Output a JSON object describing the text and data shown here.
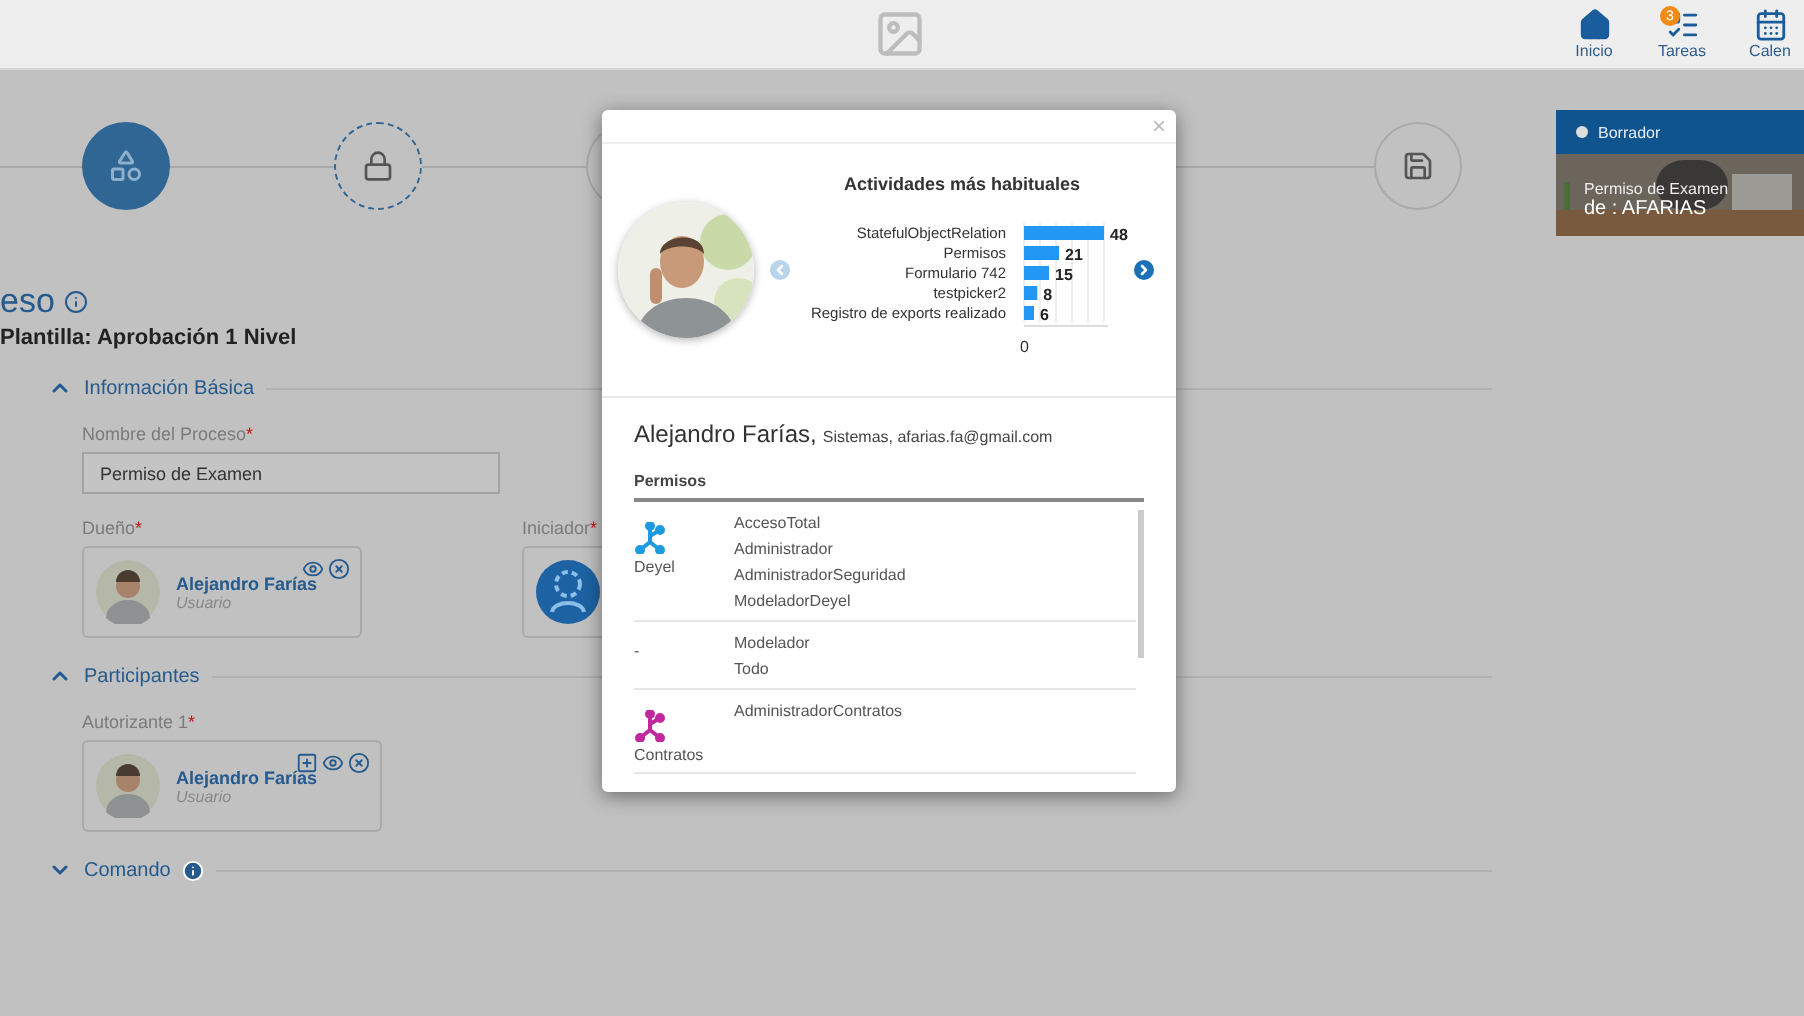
{
  "top_bar": {
    "nav": [
      {
        "kind": "home",
        "label": "Inicio"
      },
      {
        "kind": "tasks",
        "label": "Tareas",
        "badge": "3"
      },
      {
        "kind": "calendar",
        "label": "Calen"
      }
    ]
  },
  "stepper": {
    "steps": [
      {
        "kind": "shapes",
        "selected": true
      },
      {
        "kind": "lock",
        "selected": false
      },
      {
        "kind": "blank",
        "selected": false
      },
      {
        "kind": "save",
        "selected": false
      }
    ]
  },
  "form": {
    "title": "eso",
    "subtitle": "Plantilla: Aprobación 1 Nivel",
    "sections": [
      {
        "title": "Información Básica",
        "expanded": true,
        "info": false,
        "fields": [
          {
            "label": "Nombre del Proceso",
            "mark": "*",
            "value": "Permiso de Examen"
          }
        ],
        "people": [
          {
            "kind": "user",
            "label": "Dueño",
            "mark": "*",
            "name": "Alejandro Farías",
            "role": "Usuario",
            "actions": [
              {
                "kind": "view"
              },
              {
                "kind": "remove"
              }
            ]
          },
          {
            "kind": "group",
            "label": "Iniciador",
            "mark": "*"
          }
        ]
      },
      {
        "title": "Participantes",
        "expanded": true,
        "info": false,
        "people": [
          {
            "kind": "user",
            "label": "Autorizante 1",
            "mark": "*",
            "name": "Alejandro Farías",
            "role": "Usuario",
            "actions": [
              {
                "kind": "add"
              },
              {
                "kind": "view"
              },
              {
                "kind": "remove"
              }
            ]
          }
        ]
      },
      {
        "title": "Comando",
        "expanded": false,
        "info": true
      }
    ]
  },
  "draft_card": {
    "status": "Borrador",
    "title": "Permiso de Examen",
    "author": "de : AFARIAS"
  },
  "modal": {
    "close": "×",
    "carousel": [
      {
        "kind": "prev",
        "disabled": true
      },
      {
        "kind": "next",
        "disabled": false
      }
    ],
    "chart_data": {
      "type": "bar",
      "orientation": "horizontal",
      "title": "Actividades más habituales",
      "categories": [
        "StatefulObjectRelation",
        "Permisos",
        "Formulario 742",
        "testpicker2",
        "Registro de exports realizado"
      ],
      "values": [
        48,
        21,
        15,
        8,
        6
      ],
      "data_labels": true,
      "annotations": [
        {
          "text": "0"
        }
      ]
    },
    "user": {
      "name": "Alejandro Farías,",
      "detail": "Sistemas, afarias.fa@gmail.com"
    },
    "permissions_heading": "Permisos",
    "permission_groups": [
      {
        "app": "Deyel",
        "color": "#1e9be0",
        "permissions": [
          "AccesoTotal",
          "Administrador",
          "AdministradorSeguridad",
          "ModeladorDeyel"
        ]
      },
      {
        "app": "-",
        "permissions": [
          "Modelador",
          "Todo"
        ]
      },
      {
        "app": "Contratos",
        "color": "#c0289e",
        "permissions": [
          "AdministradorContratos"
        ]
      }
    ]
  }
}
